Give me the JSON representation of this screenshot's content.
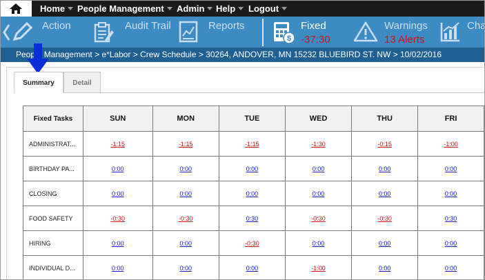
{
  "menu": {
    "items": [
      {
        "label": "Home"
      },
      {
        "label": "People Management"
      },
      {
        "label": "Admin"
      },
      {
        "label": "Help"
      },
      {
        "label": "Logout"
      }
    ]
  },
  "toolbar": {
    "action_label": "Action",
    "audit_label": "Audit Trail",
    "reports_label": "Reports",
    "fixed_label": "Fixed",
    "fixed_value": "-37:30",
    "warnings_label": "Warnings",
    "alerts_value": "13 Alerts",
    "charts_label": "Cha"
  },
  "breadcrumb": "People Management > e*Labor > Crew Schedule  > 30264, ANDOVER, MN 15232 BLUEBIRD ST. NW > 10/02/2016",
  "tabs": {
    "summary": "Summary",
    "detail": "Detail"
  },
  "table": {
    "header_first": "Fixed Tasks",
    "days": [
      "SUN",
      "MON",
      "TUE",
      "WED",
      "THU",
      "FRI"
    ],
    "rows": [
      {
        "task": "ADMINISTRAT...",
        "values": [
          "-1:15",
          "-1:15",
          "-1:15",
          "-1:30",
          "-0:15",
          "-1:00"
        ]
      },
      {
        "task": "BIRTHDAY PA...",
        "values": [
          "0:00",
          "0:00",
          "0:00",
          "0:00",
          "0:00",
          "0:00"
        ]
      },
      {
        "task": "CLOSING",
        "values": [
          "0:00",
          "0:00",
          "0:00",
          "0:00",
          "0:00",
          "0:00"
        ]
      },
      {
        "task": "FOOD SAFETY",
        "values": [
          "-0:30",
          "-0:30",
          "0:30",
          "-0:30",
          "-0:30",
          "0:30"
        ]
      },
      {
        "task": "HIRING",
        "values": [
          "0:00",
          "0:00",
          "-0:30",
          "0:00",
          "0:00",
          "0:00"
        ]
      },
      {
        "task": "INDIVIDUAL D...",
        "values": [
          "0:00",
          "0:00",
          "0:00",
          "-1:00",
          "0:00",
          "0:00"
        ]
      }
    ]
  },
  "colors": {
    "menubar": "#1b1b1b",
    "toolbar": "#3e8ac3",
    "breadcrumb_bar": "#1f5f91",
    "alert_red": "#c4161c",
    "link_blue": "#1a1ad4",
    "negative_red": "#d01010"
  },
  "icons": [
    "home-icon",
    "back-chevron-icon",
    "pencil-icon",
    "clipboard-icon",
    "reports-icon",
    "calculator-dollar-icon",
    "warning-icon",
    "bar-chart-icon",
    "down-arrow-icon"
  ]
}
